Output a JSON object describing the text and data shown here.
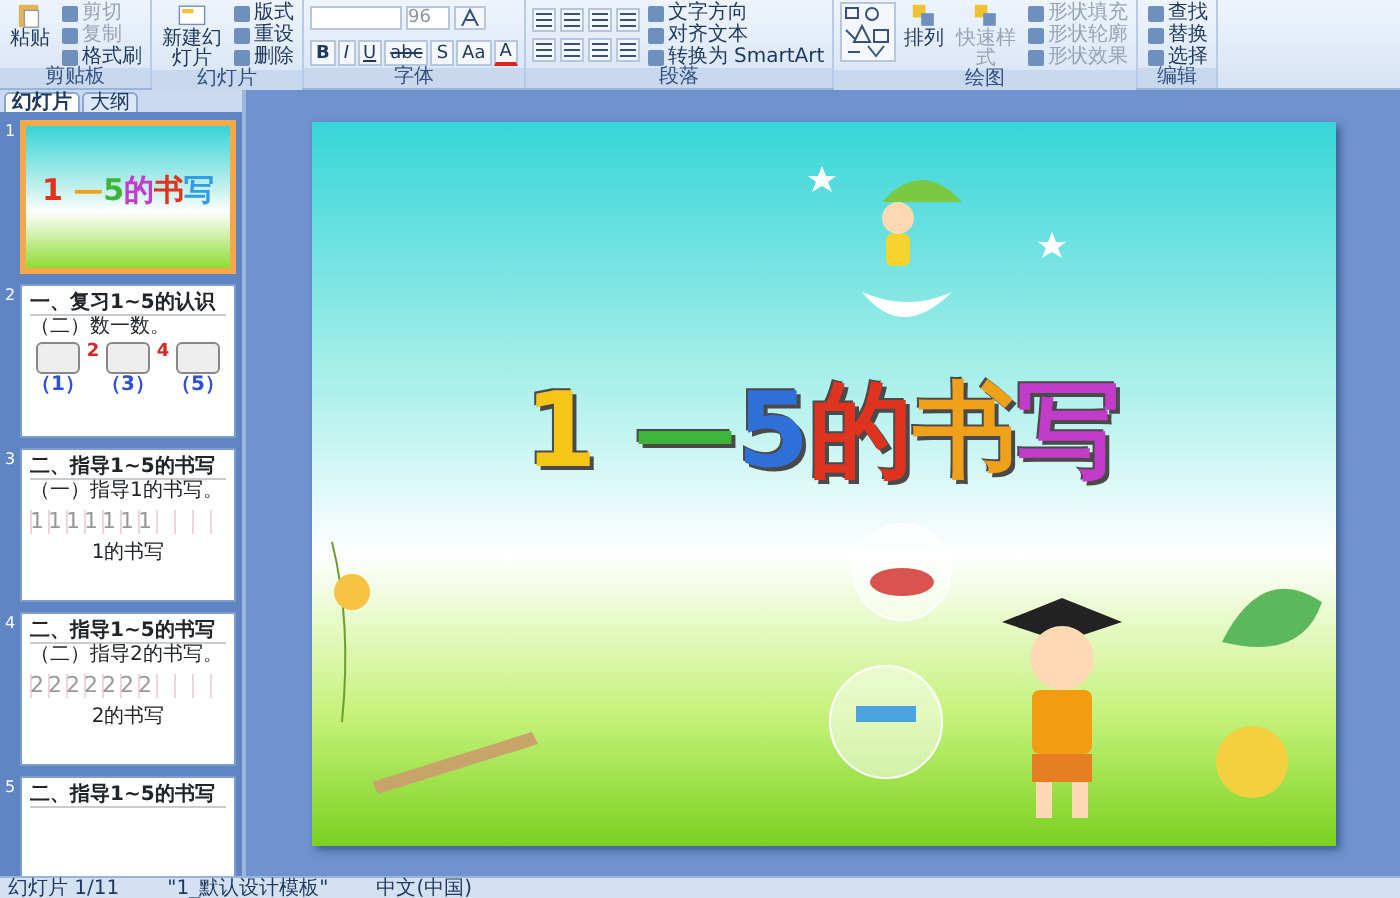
{
  "ribbon": {
    "groups": [
      {
        "kind": "clipboard",
        "label": "剪贴板",
        "items": [
          {
            "kind": "large",
            "label": "粘贴",
            "disabled": false
          },
          {
            "kind": "small",
            "label": "剪切",
            "disabled": true
          },
          {
            "kind": "small",
            "label": "复制",
            "disabled": true
          },
          {
            "kind": "small",
            "label": "格式刷",
            "disabled": false
          }
        ]
      },
      {
        "kind": "slides",
        "label": "幻灯片",
        "items": [
          {
            "kind": "large",
            "label": "新建幻灯片",
            "disabled": false
          },
          {
            "kind": "small",
            "label": "版式",
            "disabled": false
          },
          {
            "kind": "small",
            "label": "重设",
            "disabled": false
          },
          {
            "kind": "small",
            "label": "删除",
            "disabled": false
          }
        ]
      },
      {
        "kind": "font",
        "label": "字体",
        "items": [
          {
            "kind": "field",
            "label": "96",
            "disabled": true
          },
          {
            "kind": "glyph",
            "label": "B",
            "disabled": false
          },
          {
            "kind": "glyph",
            "label": "I",
            "disabled": false
          },
          {
            "kind": "glyph",
            "label": "U",
            "disabled": false
          },
          {
            "kind": "glyph",
            "label": "abc",
            "disabled": false
          },
          {
            "kind": "glyph",
            "label": "S",
            "disabled": false
          },
          {
            "kind": "glyph",
            "label": "Aa",
            "disabled": false
          },
          {
            "kind": "glyph",
            "label": "A",
            "disabled": false
          }
        ]
      },
      {
        "kind": "paragraph",
        "label": "段落",
        "items": [
          {
            "kind": "small",
            "label": "文字方向",
            "disabled": false
          },
          {
            "kind": "small",
            "label": "对齐文本",
            "disabled": false
          },
          {
            "kind": "small",
            "label": "转换为 SmartArt",
            "disabled": false
          }
        ]
      },
      {
        "kind": "drawing",
        "label": "绘图",
        "items": [
          {
            "kind": "large",
            "label": "排列",
            "disabled": false
          },
          {
            "kind": "large",
            "label": "快速样式",
            "disabled": true
          },
          {
            "kind": "small",
            "label": "形状填充",
            "disabled": true
          },
          {
            "kind": "small",
            "label": "形状轮廓",
            "disabled": true
          },
          {
            "kind": "small",
            "label": "形状效果",
            "disabled": true
          }
        ]
      },
      {
        "kind": "editing",
        "label": "编辑",
        "items": [
          {
            "kind": "small",
            "label": "查找",
            "disabled": false
          },
          {
            "kind": "small",
            "label": "替换",
            "disabled": false
          },
          {
            "kind": "small",
            "label": "选择",
            "disabled": false
          }
        ]
      }
    ]
  },
  "panel": {
    "tabs": [
      {
        "label": "幻灯片",
        "selected": true
      },
      {
        "label": "大纲",
        "selected": false
      }
    ],
    "slides": [
      {
        "number": "1",
        "selected": true,
        "kind": "title",
        "title": "1 —5的书写"
      },
      {
        "number": "2",
        "selected": false,
        "kind": "pictures",
        "heading": "一、复习1~5的认识",
        "subheading": "（二）数一数。",
        "labels": [
          "（1）",
          "（3）",
          "（5）"
        ],
        "marks": [
          "2",
          "4"
        ]
      },
      {
        "number": "3",
        "selected": false,
        "kind": "writing",
        "heading": "二、指导1~5的书写",
        "subheading": "（一）指导1的书写。",
        "practice": "1111111",
        "caption": "1的书写"
      },
      {
        "number": "4",
        "selected": false,
        "kind": "writing",
        "heading": "二、指导1~5的书写",
        "subheading": "（二）指导2的书写。",
        "practice": "2222222",
        "caption": "2的书写"
      },
      {
        "number": "5",
        "selected": false,
        "kind": "heading",
        "heading": "二、指导1~5的书写"
      }
    ]
  },
  "slide": {
    "title": "1 —5的书写"
  },
  "status_bar": {
    "items": [
      "幻灯片 1/11",
      "\"1_默认设计模板\"",
      "中文(中国)"
    ]
  }
}
